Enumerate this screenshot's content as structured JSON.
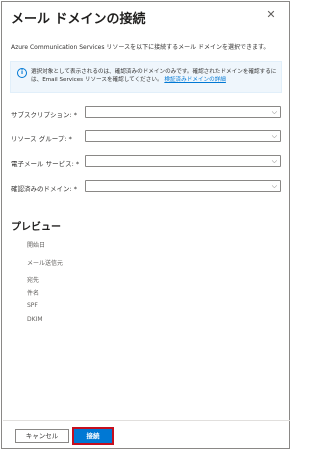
{
  "panel": {
    "title": "メール ドメインの接続",
    "close_icon": "close-icon",
    "description": "Azure Communication Services リソースを以下に接続するメール ドメインを選択できます。"
  },
  "info": {
    "icon": "info-icon",
    "text": "選択対象として表示されるのは、確認済みのドメインのみです。確認されたドメインを確認するには、Email Services リソースを確認してください。",
    "link": "検証済みドメインの詳細"
  },
  "form": {
    "subscription_label": "サブスクリプション: *",
    "resource_group_label": "リソース グループ: *",
    "email_service_label": "電子メール サービス: *",
    "verified_domain_label": "確認済みのドメイン: *"
  },
  "preview": {
    "title": "プレビュー",
    "labels": [
      "開始日",
      "メール送信元",
      "宛先",
      "件名",
      "SPF",
      "DKIM"
    ]
  },
  "footer": {
    "cancel_label": "キャンセル",
    "connect_label": "接続"
  },
  "colors": {
    "accent": "#0078d4",
    "highlight_outline": "#c50f1f",
    "info_bg": "#eff6fc"
  }
}
